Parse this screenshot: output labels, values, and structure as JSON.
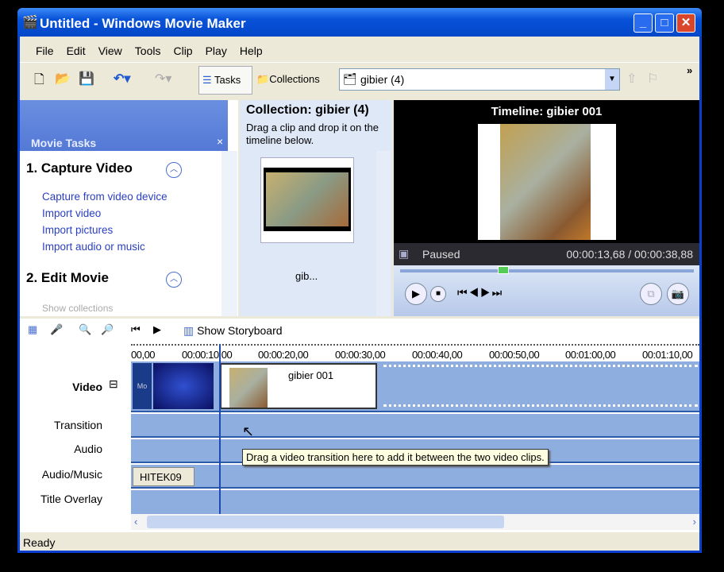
{
  "window": {
    "title": "Untitled - Windows Movie Maker"
  },
  "menu": [
    "File",
    "Edit",
    "View",
    "Tools",
    "Clip",
    "Play",
    "Help"
  ],
  "toolbar": {
    "tasks": "Tasks",
    "collections": "Collections",
    "collection_value": "gibier (4)",
    "overflow": "»"
  },
  "tasks_pane": {
    "header": "Movie Tasks",
    "close": "×",
    "section1": "1. Capture Video",
    "links1": [
      "Capture from video device",
      "Import video",
      "Import pictures",
      "Import audio or music"
    ],
    "section2": "2. Edit Movie",
    "link2": "Show collections"
  },
  "collection": {
    "title": "Collection: gibier (4)",
    "hint": "Drag a clip and drop it on the timeline below.",
    "clip_label": "gib..."
  },
  "preview": {
    "title": "Timeline: gibier 001",
    "status": "Paused",
    "time": "00:00:13,68 / 00:00:38,88",
    "seek_position": 0.35
  },
  "timeline": {
    "show_storyboard": "Show Storyboard",
    "ticks": [
      "00,00",
      "00:00:10,00",
      "00:00:20,00",
      "00:00:30,00",
      "00:00:40,00",
      "00:00:50,00",
      "00:01:00,00",
      "00:01:10,00"
    ],
    "tracks": [
      "Video",
      "Transition",
      "Audio",
      "Audio/Music",
      "Title Overlay"
    ],
    "collapse": "⊟",
    "clip1_label": "Mo",
    "clip2_label": "gibier 001",
    "music_clip": "HITEK09",
    "tooltip": "Drag a video transition here to add it between the two video clips."
  },
  "status": "Ready"
}
